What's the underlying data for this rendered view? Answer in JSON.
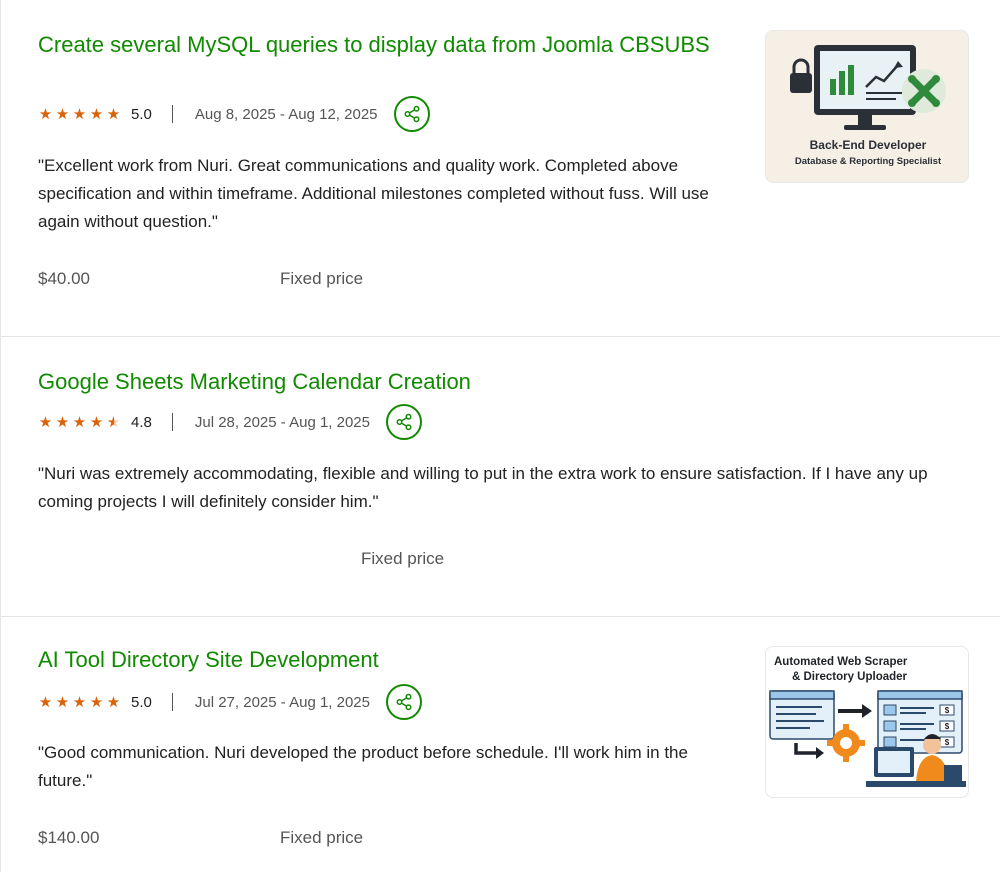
{
  "jobs": [
    {
      "title": "Create several MySQL queries to display data from Joomla CBSUBS",
      "rating": "5.0",
      "stars": 5,
      "dates": "Aug 8, 2025 - Aug 12, 2025",
      "review": "\"Excellent work from Nuri. Great communications and quality work. Completed above specification and within timeframe. Additional milestones completed without fuss. Will use again without question.\"",
      "price": "$40.00",
      "price_type": "Fixed price",
      "thumb": {
        "line1": "Back-End Developer",
        "line2": "Database & Reporting Specialist"
      }
    },
    {
      "title": "Google Sheets Marketing Calendar Creation",
      "rating": "4.8",
      "stars": 4.8,
      "dates": "Jul 28, 2025 - Aug 1, 2025",
      "review": "\"Nuri was extremely accommodating, flexible and willing to put in the extra work to ensure satisfaction. If I have any up coming projects I will definitely consider him.\"",
      "price": "",
      "price_type": "Fixed price"
    },
    {
      "title": "AI Tool Directory Site Development",
      "rating": "5.0",
      "stars": 5,
      "dates": "Jul 27, 2025 - Aug 1, 2025",
      "review": "\"Good communication. Nuri developed the product before schedule. I'll work him in the future.\"",
      "price": "$140.00",
      "price_type": "Fixed price",
      "thumb": {
        "line1": "Automated Web Scraper",
        "line2": "& Directory Uploader",
        "dollar": "$"
      }
    }
  ],
  "colors": {
    "accent": "#108a00",
    "star": "#d9620b",
    "muted": "#555555"
  },
  "icons": {
    "share": "share-icon",
    "star": "star-icon"
  }
}
